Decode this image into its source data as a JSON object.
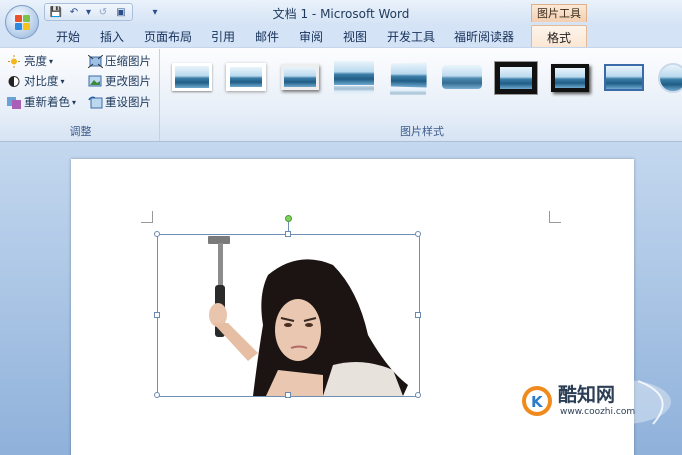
{
  "window": {
    "title": "文档 1 - Microsoft Word",
    "context_tool": "图片工具"
  },
  "quick_access": {
    "save_icon": "💾",
    "undo_icon": "↶",
    "undo_dropdown": "▾",
    "redo_icon": "↺",
    "print_icon": "▣",
    "more_icon": "▾"
  },
  "tabs": [
    {
      "label": "开始"
    },
    {
      "label": "插入"
    },
    {
      "label": "页面布局"
    },
    {
      "label": "引用"
    },
    {
      "label": "邮件"
    },
    {
      "label": "审阅"
    },
    {
      "label": "视图"
    },
    {
      "label": "开发工具"
    },
    {
      "label": "福昕阅读器"
    },
    {
      "label": "格式",
      "active": true
    }
  ],
  "ribbon": {
    "adjust": {
      "label": "调整",
      "brightness": "亮度",
      "contrast": "对比度",
      "recolor": "重新着色",
      "compress": "压缩图片",
      "change": "更改图片",
      "reset": "重设图片",
      "dropdown": "▾"
    },
    "styles": {
      "label": "图片样式"
    }
  },
  "watermark": {
    "brand": "酷知网",
    "url": "www.coozhi.com"
  },
  "colors": {
    "accent": "#2b579a",
    "tab_active": "#fbe6d3",
    "ribbon_bg": "#dfe9f5"
  }
}
